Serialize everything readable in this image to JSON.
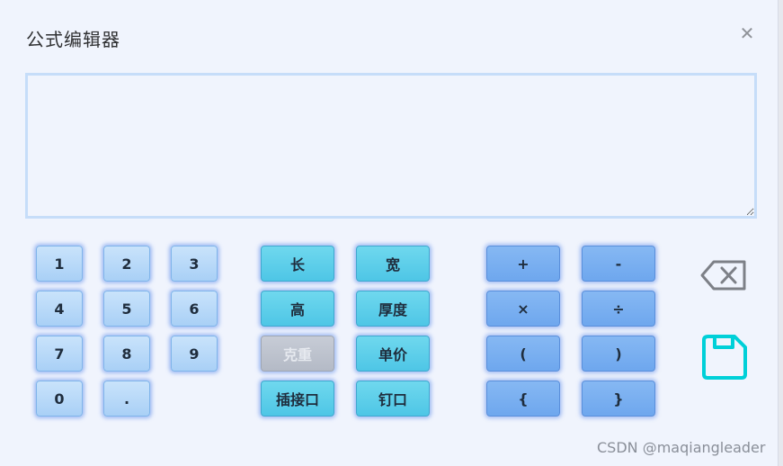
{
  "dialog": {
    "title": "公式编辑器",
    "close_icon": "close-icon"
  },
  "editor": {
    "value": "",
    "placeholder": ""
  },
  "numpad": [
    "1",
    "2",
    "3",
    "4",
    "5",
    "6",
    "7",
    "8",
    "9",
    "0",
    "."
  ],
  "variables": {
    "length": "长",
    "width": "宽",
    "height": "高",
    "thickness": "厚度",
    "gram_weight": "克重",
    "unit_price": "单价",
    "socket": "插接口",
    "nail": "钉口"
  },
  "operators": {
    "plus": "+",
    "minus": "-",
    "multiply": "×",
    "divide": "÷",
    "lparen": "(",
    "rparen": ")",
    "lbrace": "{",
    "rbrace": "}"
  },
  "actions": {
    "backspace_icon": "backspace-icon",
    "save_icon": "save-icon"
  },
  "colors": {
    "accent": "#00d0d8",
    "icon_gray": "#7d8087"
  },
  "watermark": "CSDN @maqiangleader"
}
